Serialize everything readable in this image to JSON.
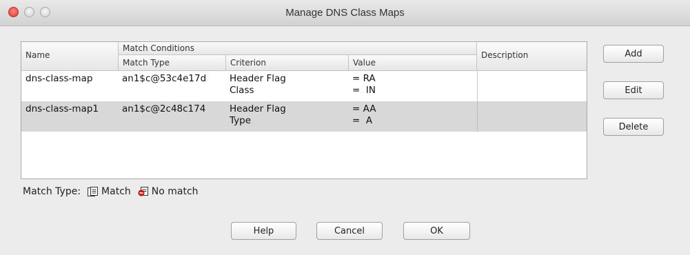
{
  "window": {
    "title": "Manage DNS Class Maps"
  },
  "table": {
    "headers": {
      "name": "Name",
      "match_conditions": "Match Conditions",
      "match_type": "Match Type",
      "criterion": "Criterion",
      "value": "Value",
      "description": "Description"
    },
    "rows": [
      {
        "name": "dns-class-map",
        "match_type": "an1$c@53c4e17d",
        "criterion_1": "Header Flag",
        "criterion_2": "Class",
        "value_1": "= RA",
        "value_2": "=  IN",
        "description": ""
      },
      {
        "name": "dns-class-map1",
        "match_type": "an1$c@2c48c174",
        "criterion_1": "Header Flag",
        "criterion_2": "Type",
        "value_1": "= AA",
        "value_2": "=  A",
        "description": ""
      }
    ]
  },
  "side_buttons": {
    "add": "Add",
    "edit": "Edit",
    "delete": "Delete"
  },
  "legend": {
    "label": "Match Type:",
    "match": "Match",
    "no_match": "No match"
  },
  "bottom_buttons": {
    "help": "Help",
    "cancel": "Cancel",
    "ok": "OK"
  },
  "colors": {
    "selected_row": "#d8d8d8",
    "close_button": "#d9352c",
    "no_match_icon": "#c0211b"
  }
}
